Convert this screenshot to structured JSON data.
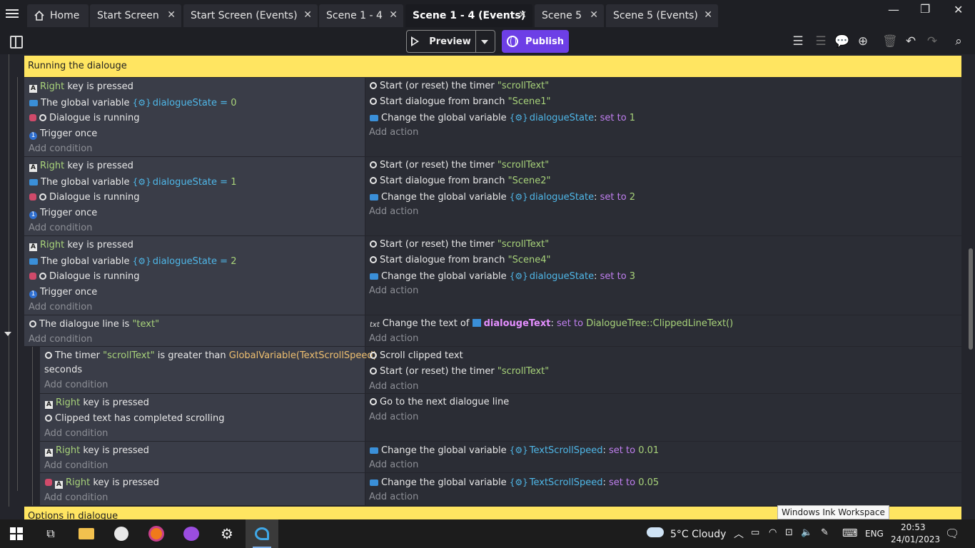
{
  "tabs": [
    {
      "label": "Home"
    },
    {
      "label": "Start Screen"
    },
    {
      "label": "Start Screen (Events)"
    },
    {
      "label": "Scene 1 - 4"
    },
    {
      "label": "Scene 1 - 4 (Events)"
    },
    {
      "label": "Scene 5"
    },
    {
      "label": "Scene 5 (Events)"
    }
  ],
  "toolbar": {
    "preview_label": "Preview",
    "publish_label": "Publish"
  },
  "groups": {
    "running": "Running the dialouge",
    "options": "Options in dialogue"
  },
  "common": {
    "right": "Right",
    "key_pressed": " key is pressed",
    "global_var": "The global variable ",
    "dialogue_state": "dialogueState",
    "dialogue_running": "Dialogue is running",
    "trigger_once": "Trigger once",
    "add_condition": "Add condition",
    "add_action": "Add action",
    "start_timer": "Start (or reset) the timer ",
    "scroll_text_q": "\"scrollText\"",
    "start_dialogue": "Start dialogue from branch ",
    "change_global": "Change the global variable ",
    "set_to": "set to",
    "eq": "=",
    "colon": ":"
  },
  "events": [
    {
      "value": "0",
      "branch": "\"Scene1\"",
      "set": "1"
    },
    {
      "value": "1",
      "branch": "\"Scene2\"",
      "set": "2"
    },
    {
      "value": "2",
      "branch": "\"Scene4\"",
      "set": "3"
    }
  ],
  "dialogue_line": {
    "cond_prefix": "The dialogue line is ",
    "cond_value": "\"text\"",
    "act_icon": "txt",
    "act_prefix": "Change the text of ",
    "object": "dialougeText",
    "expr": "DialogueTree::ClippedLineText()"
  },
  "sub1": {
    "cond_prefix": "The timer ",
    "cond_mid": " is greater than ",
    "expr": "GlobalVariable(TextScrollSpeed)",
    "seconds": "seconds",
    "act1": "Scroll clipped text"
  },
  "sub2": {
    "cond2": "Clipped text has completed scrolling",
    "act1": "Go to the next dialogue line"
  },
  "sub3": {
    "var": "TextScrollSpeed",
    "value": "0.01"
  },
  "sub4": {
    "var": "TextScrollSpeed",
    "value": "0.05"
  },
  "taskbar": {
    "weather_temp": "5°C",
    "weather_desc": "Cloudy",
    "lang": "ENG",
    "time": "20:53",
    "date": "24/01/2023",
    "tooltip": "Windows Ink Workspace"
  },
  "colors": {
    "group_bar": "#ffe561",
    "publish": "#6d3fe6",
    "cond_bg": "#3a3d48",
    "act_bg": "#2b2d35"
  }
}
